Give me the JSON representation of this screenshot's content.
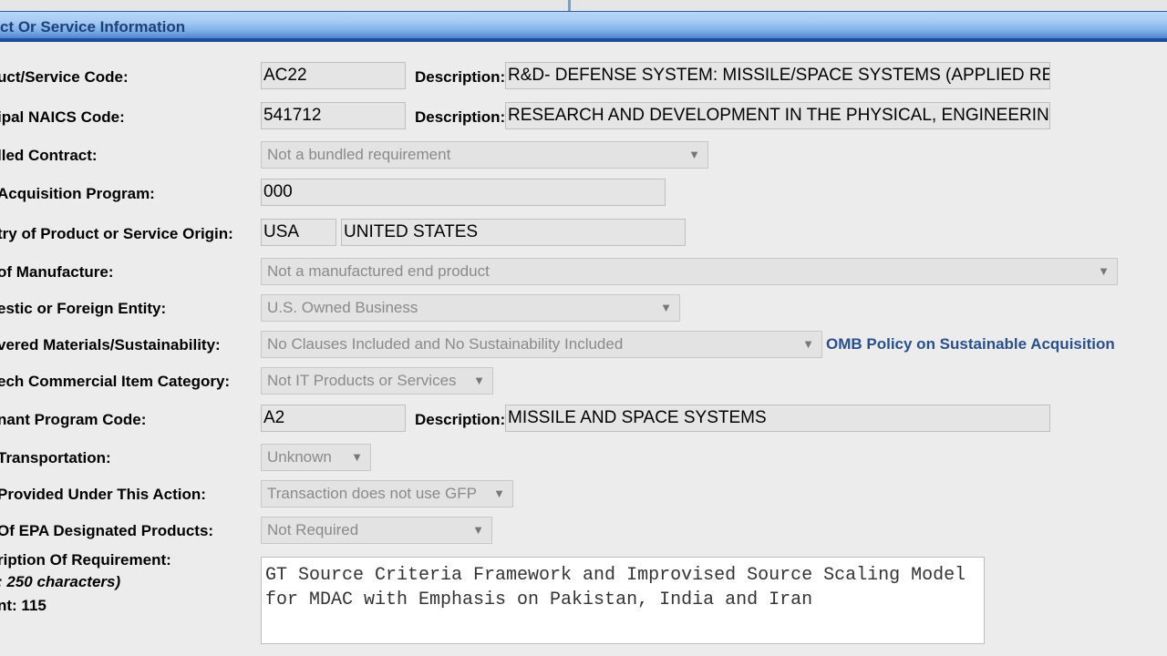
{
  "section": {
    "title": "ct Or Service Information"
  },
  "fields": {
    "product_service_code": {
      "label": "uct/Service Code:",
      "value": "AC22",
      "desc_label": "Description:",
      "desc_value": "R&D- DEFENSE SYSTEM: MISSILE/SPACE SYSTEMS (APPLIED RESE"
    },
    "naics_code": {
      "label": "ipal NAICS Code:",
      "value": "541712",
      "desc_label": "Description:",
      "desc_value": "RESEARCH AND DEVELOPMENT IN THE PHYSICAL, ENGINEERING, A"
    },
    "bundled_contract": {
      "label": "lled Contract:",
      "value": "Not a bundled requirement"
    },
    "acquisition_program": {
      "label": "Acquisition Program:",
      "value": "000"
    },
    "country_origin": {
      "label": "try of Product or Service Origin:",
      "code": "USA",
      "name": "UNITED STATES"
    },
    "place_manufacture": {
      "label": "of Manufacture:",
      "value": "Not a manufactured end product"
    },
    "domestic_foreign": {
      "label": "estic or Foreign Entity:",
      "value": "U.S. Owned Business"
    },
    "recovered_materials": {
      "label": "vered Materials/Sustainability:",
      "value": "No Clauses Included and No Sustainability Included",
      "link": "OMB Policy on Sustainable Acquisition"
    },
    "it_commercial": {
      "label": "ech Commercial Item Category:",
      "value": "Not IT Products or Services"
    },
    "claimant_program": {
      "label": "nant Program Code:",
      "value": "A2",
      "desc_label": "Description:",
      "desc_value": "MISSILE AND SPACE SYSTEMS"
    },
    "transportation": {
      "label": "Transportation:",
      "value": "Unknown"
    },
    "gfp": {
      "label": "Provided Under This Action:",
      "value": "Transaction does not use GFP"
    },
    "epa_products": {
      "label": "Of EPA Designated Products:",
      "value": "Not Required"
    },
    "description_req": {
      "label": "ription Of Requirement:",
      "limit": ": 250 characters)",
      "count": "nt: 115",
      "value": "GT Source Criteria Framework and Improvised Source Scaling Model\nfor MDAC with Emphasis on Pakistan, India and Iran"
    }
  },
  "icons": {
    "dropdown": "chevron-down-icon"
  },
  "colors": {
    "header_text": "#1d3f7a",
    "link": "#2a4f8f",
    "header_border": "#1f4f9a"
  }
}
